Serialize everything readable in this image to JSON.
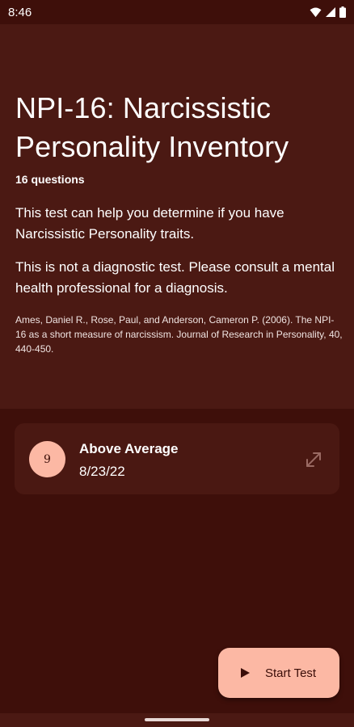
{
  "status_bar": {
    "time": "8:46"
  },
  "test": {
    "title": "NPI-16: Narcissistic Personality Inventory",
    "question_count": "16 questions",
    "description": "This test can help you determine if you have Narcissistic Personality traits.",
    "disclaimer": "This is not a diagnostic test. Please consult a mental health professional for a diagnosis.",
    "citation": "Ames, Daniel R., Rose, Paul, and Anderson, Cameron P. (2006). The NPI-16 as a short measure of narcissism. Journal of Research in Personality, 40, 440-450."
  },
  "result": {
    "score": "9",
    "label": "Above Average",
    "date": "8/23/22"
  },
  "actions": {
    "start_label": "Start Test"
  },
  "icons": {
    "expand": "expand-icon",
    "play": "play-icon",
    "wifi": "wifi-icon",
    "signal": "signal-icon",
    "battery": "battery-icon"
  },
  "colors": {
    "background": "#3e0f0a",
    "header_panel": "#4b1913",
    "card": "#4a1812",
    "accent": "#fcb8a4"
  }
}
